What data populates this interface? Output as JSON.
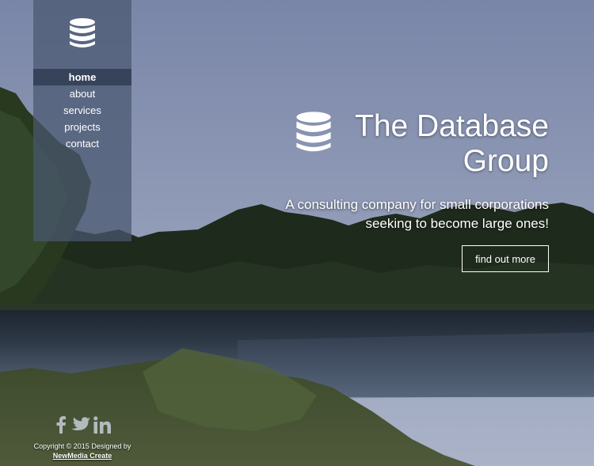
{
  "icons": {
    "logo": "database-icon",
    "social": [
      "facebook-icon",
      "twitter-icon",
      "linkedin-icon"
    ]
  },
  "colors": {
    "sky_top": "#7a86a8",
    "sky_bottom": "#a9b2c9",
    "sidebar": "#4a5870",
    "text": "#ffffff"
  },
  "nav": {
    "items": [
      {
        "label": "home",
        "active": true
      },
      {
        "label": "about",
        "active": false
      },
      {
        "label": "services",
        "active": false
      },
      {
        "label": "projects",
        "active": false
      },
      {
        "label": "contact",
        "active": false
      }
    ]
  },
  "hero": {
    "title_line1": "The Database",
    "title_line2": "Group",
    "tagline_line1": "A consulting company for small corporations",
    "tagline_line2": "seeking to become large ones!",
    "cta_label": "find out more"
  },
  "footer": {
    "copyright": "Copyright © 2015 Designed by",
    "designer": "NewMedia Create"
  }
}
